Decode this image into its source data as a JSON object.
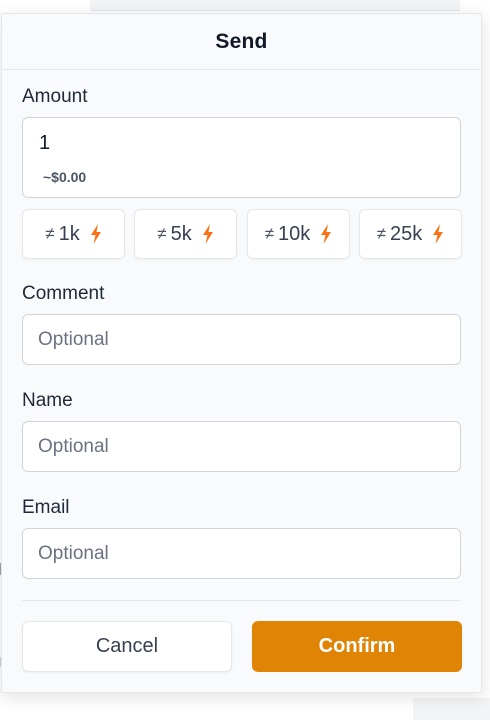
{
  "dialog": {
    "title": "Send"
  },
  "amount": {
    "label": "Amount",
    "value": "1",
    "fiat": "~$0.00"
  },
  "presets": [
    {
      "symbol": "≠",
      "label": "1k"
    },
    {
      "symbol": "≠",
      "label": "5k"
    },
    {
      "symbol": "≠",
      "label": "10k"
    },
    {
      "symbol": "≠",
      "label": "25k"
    }
  ],
  "comment": {
    "label": "Comment",
    "placeholder": "Optional"
  },
  "name": {
    "label": "Name",
    "placeholder": "Optional"
  },
  "email": {
    "label": "Email",
    "placeholder": "Optional"
  },
  "actions": {
    "cancel_label": "Cancel",
    "confirm_label": "Confirm"
  },
  "colors": {
    "accent": "#e08405",
    "bolt": "#f97316",
    "panel_bg": "#f9fafb",
    "border": "#d1d5db"
  },
  "icons": {
    "sat": "satoshi-symbol-icon",
    "lightning": "lightning-bolt-icon"
  }
}
